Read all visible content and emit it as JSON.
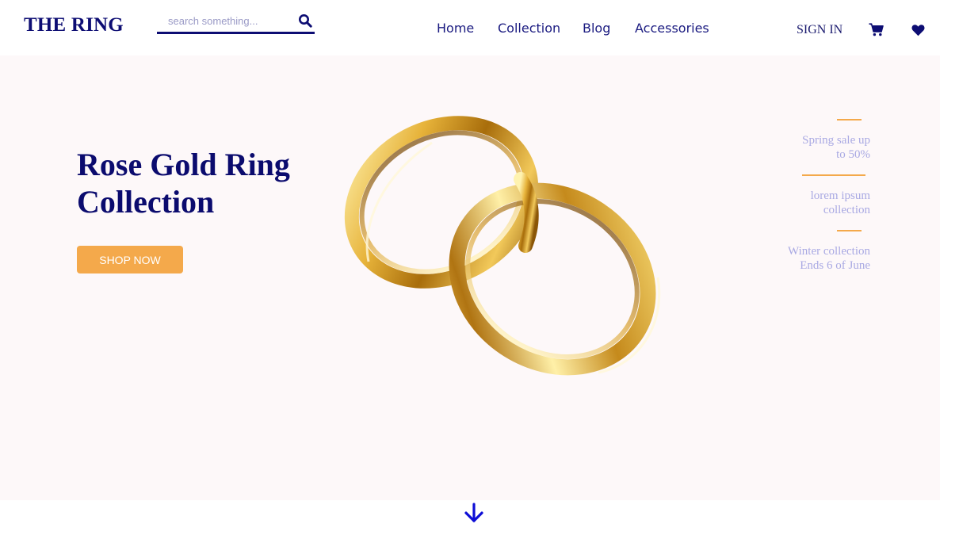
{
  "header": {
    "logo": "THE RING",
    "search": {
      "placeholder": "search something..."
    },
    "nav": [
      {
        "label": "Home"
      },
      {
        "label": "Collection"
      },
      {
        "label": "Blog"
      },
      {
        "label": "Accessories"
      }
    ],
    "signin_label": "SIGN IN",
    "icons": [
      "search-icon",
      "cart-icon",
      "heart-icon"
    ]
  },
  "hero": {
    "title": "Rose Gold Ring Collection",
    "button_label": "SHOP NOW",
    "image": "gold-wedding-rings",
    "promos": [
      {
        "line1": "Spring sale up",
        "line2": "to 50%"
      },
      {
        "line1": "lorem ipsum",
        "line2": "collection"
      },
      {
        "line1": "Winter collection",
        "line2": "Ends 6 of June"
      }
    ]
  },
  "scroll_icon": "arrow-down-icon",
  "colors": {
    "brand": "#0d0d73",
    "accent": "#f4a94b",
    "hero_background": "#fdf8f9",
    "promo_text": "#a9a9e3"
  }
}
